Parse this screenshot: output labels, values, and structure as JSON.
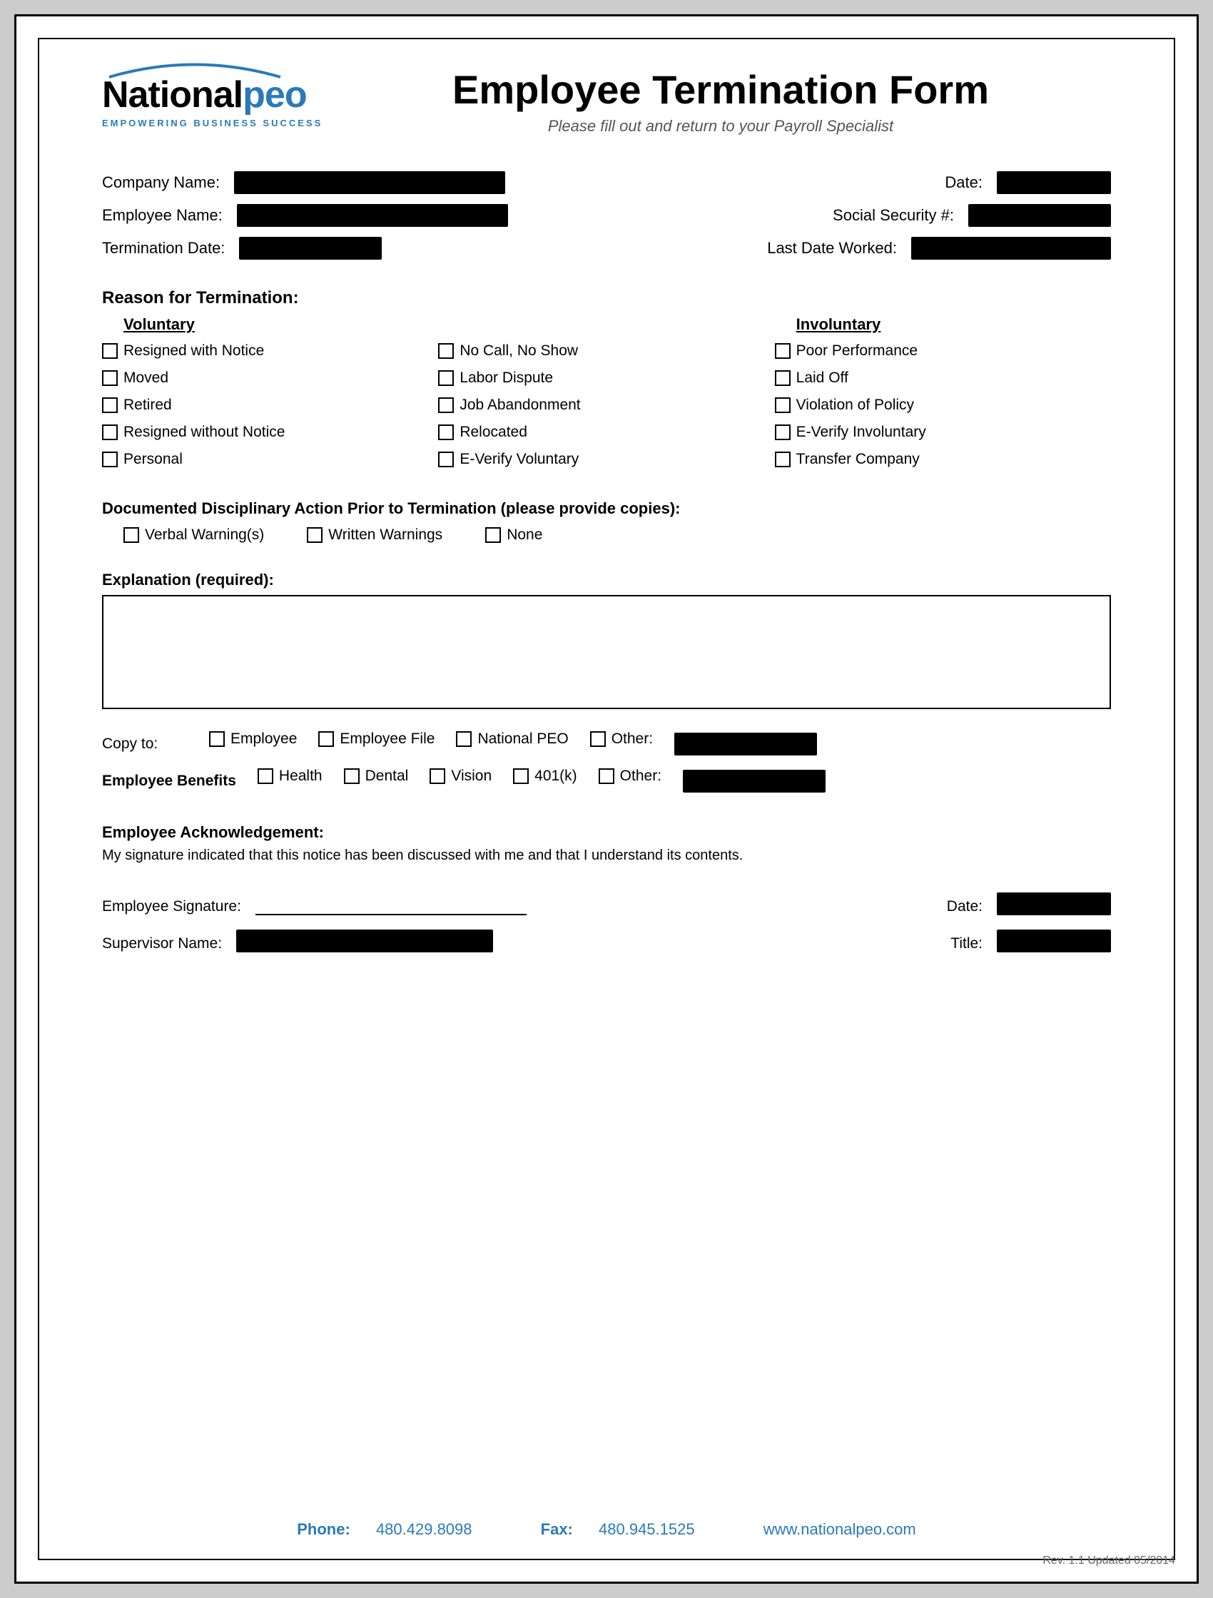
{
  "header": {
    "logo": {
      "national": "National",
      "peo": "peo",
      "tagline": "Empowering Business Success"
    },
    "title": "Employee Termination Form",
    "subtitle": "Please fill out and return to your Payroll Specialist"
  },
  "fields": {
    "company_name_label": "Company Name:",
    "date_label": "Date:",
    "employee_name_label": "Employee Name:",
    "ssn_label": "Social Security #:",
    "termination_date_label": "Termination Date:",
    "last_date_worked_label": "Last Date Worked:"
  },
  "reason_section": {
    "title": "Reason for Termination:",
    "voluntary_header": "Voluntary",
    "involuntary_header": "Involuntary",
    "voluntary_col1": [
      "Resigned with Notice",
      "Moved",
      "Retired",
      "Resigned without Notice",
      "Personal"
    ],
    "voluntary_col2": [
      "No Call, No Show",
      "Labor Dispute",
      "Job Abandonment",
      "Relocated",
      "E-Verify Voluntary"
    ],
    "involuntary_col": [
      "Poor Performance",
      "Laid Off",
      "Violation of Policy",
      "E-Verify Involuntary",
      "Transfer Company"
    ]
  },
  "disciplinary": {
    "title": "Documented Disciplinary Action Prior to Termination (please provide copies):",
    "options": [
      "Verbal Warning(s)",
      "Written Warnings",
      "None"
    ]
  },
  "explanation": {
    "label": "Explanation (required):"
  },
  "copy_to": {
    "label": "Copy to:",
    "options": [
      "Employee",
      "Employee File",
      "National PEO"
    ],
    "other_label": "Other:"
  },
  "benefits": {
    "label": "Employee Benefits",
    "options": [
      "Health",
      "Dental",
      "Vision",
      "401(k)"
    ],
    "other_label": "Other:"
  },
  "acknowledgement": {
    "title": "Employee Acknowledgement:",
    "text": "My signature indicated that this notice has been discussed with me and that I understand its contents."
  },
  "signature": {
    "employee_sig_label": "Employee Signature:",
    "date_label": "Date:",
    "supervisor_label": "Supervisor Name:",
    "title_label": "Title:"
  },
  "footer": {
    "phone_label": "Phone:",
    "phone": "480.429.8098",
    "fax_label": "Fax:",
    "fax": "480.945.1525",
    "website": "www.nationalpeo.com",
    "rev": "Rev. 1.1  Updated 05/2014"
  }
}
